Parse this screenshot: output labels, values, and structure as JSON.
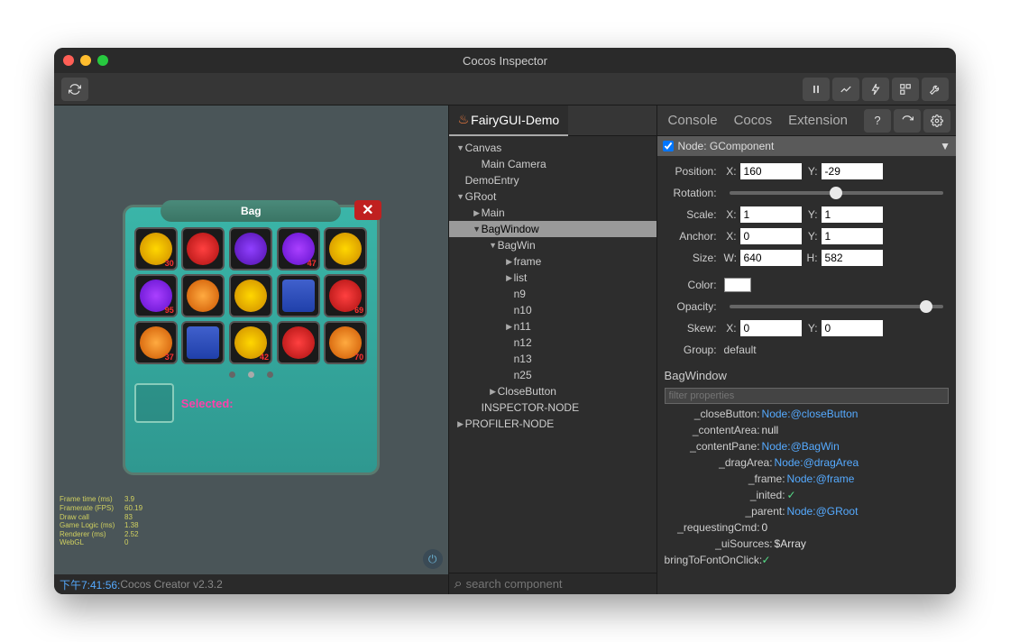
{
  "window": {
    "title": "Cocos Inspector"
  },
  "toolbar": {
    "refresh": "⟳",
    "pause": "⏸"
  },
  "tabs": {
    "main": "FairyGUI-Demo",
    "others": [
      "Console",
      "Cocos",
      "Extension"
    ]
  },
  "preview": {
    "bag_title": "Bag",
    "selected_label": "Selected:",
    "item_counts": [
      "30",
      "",
      "",
      "47",
      "",
      "95",
      "",
      "",
      "",
      "69",
      "37",
      "",
      "42",
      "",
      "70"
    ],
    "stats": [
      {
        "k": "Frame time (ms)",
        "v": "3.9"
      },
      {
        "k": "Framerate (FPS)",
        "v": "60.19"
      },
      {
        "k": "Draw call",
        "v": "83"
      },
      {
        "k": "Game Logic (ms)",
        "v": "1.38"
      },
      {
        "k": "Renderer (ms)",
        "v": "2.52"
      },
      {
        "k": "WebGL",
        "v": "0"
      }
    ]
  },
  "console": {
    "timestamp": "下午7:41:56:",
    "message": "Cocos Creator v2.3.2"
  },
  "tree": [
    {
      "label": "Canvas",
      "depth": 0,
      "arrow": "down"
    },
    {
      "label": "Main Camera",
      "depth": 1,
      "arrow": ""
    },
    {
      "label": "DemoEntry",
      "depth": 0,
      "arrow": ""
    },
    {
      "label": "GRoot",
      "depth": 0,
      "arrow": "down"
    },
    {
      "label": "Main",
      "depth": 1,
      "arrow": "right"
    },
    {
      "label": "BagWindow",
      "depth": 1,
      "arrow": "down",
      "selected": true
    },
    {
      "label": "BagWin",
      "depth": 2,
      "arrow": "down"
    },
    {
      "label": "frame",
      "depth": 3,
      "arrow": "right"
    },
    {
      "label": "list",
      "depth": 3,
      "arrow": "right"
    },
    {
      "label": "n9",
      "depth": 3,
      "arrow": ""
    },
    {
      "label": "n10",
      "depth": 3,
      "arrow": ""
    },
    {
      "label": "n11",
      "depth": 3,
      "arrow": "right"
    },
    {
      "label": "n12",
      "depth": 3,
      "arrow": ""
    },
    {
      "label": "n13",
      "depth": 3,
      "arrow": ""
    },
    {
      "label": "n25",
      "depth": 3,
      "arrow": ""
    },
    {
      "label": "CloseButton",
      "depth": 2,
      "arrow": "right"
    },
    {
      "label": "INSPECTOR-NODE",
      "depth": 1,
      "arrow": ""
    },
    {
      "label": "PROFILER-NODE",
      "depth": 0,
      "arrow": "right"
    }
  ],
  "search": {
    "placeholder": "search component"
  },
  "inspector": {
    "node_enabled": true,
    "node_label": "Node: GComponent",
    "position": {
      "label": "Position:",
      "x": "160",
      "y": "-29"
    },
    "rotation": {
      "label": "Rotation:",
      "value": 0.5
    },
    "scale": {
      "label": "Scale:",
      "x": "1",
      "y": "1"
    },
    "anchor": {
      "label": "Anchor:",
      "x": "0",
      "y": "1"
    },
    "size": {
      "label": "Size:",
      "w": "640",
      "h": "582"
    },
    "color": {
      "label": "Color:",
      "value": "#ffffff"
    },
    "opacity": {
      "label": "Opacity:",
      "value": 0.92
    },
    "skew": {
      "label": "Skew:",
      "x": "0",
      "y": "0"
    },
    "group": {
      "label": "Group:",
      "value": "default"
    },
    "component_name": "BagWindow",
    "filter_placeholder": "filter properties",
    "props": [
      {
        "key": "_closeButton:",
        "val": "Node:@closeButton",
        "type": "link",
        "indent": 0
      },
      {
        "key": "_contentArea:",
        "val": "null",
        "type": "null",
        "indent": 0
      },
      {
        "key": "_contentPane:",
        "val": "Node:@BagWin",
        "type": "link",
        "indent": 0
      },
      {
        "key": "_dragArea:",
        "val": "Node:@dragArea",
        "type": "link",
        "indent": 1
      },
      {
        "key": "_frame:",
        "val": "Node:@frame",
        "type": "link",
        "indent": 2
      },
      {
        "key": "_inited:",
        "val": "✓",
        "type": "check",
        "indent": 2
      },
      {
        "key": "_parent:",
        "val": "Node:@GRoot",
        "type": "link",
        "indent": 2
      },
      {
        "key": "_requestingCmd:",
        "val": "0",
        "type": "str",
        "indent": 0
      },
      {
        "key": "_uiSources:",
        "val": "$Array",
        "type": "str",
        "indent": 1
      },
      {
        "key": "bringToFontOnClick:",
        "val": "✓",
        "type": "check",
        "indent": 0
      }
    ]
  }
}
